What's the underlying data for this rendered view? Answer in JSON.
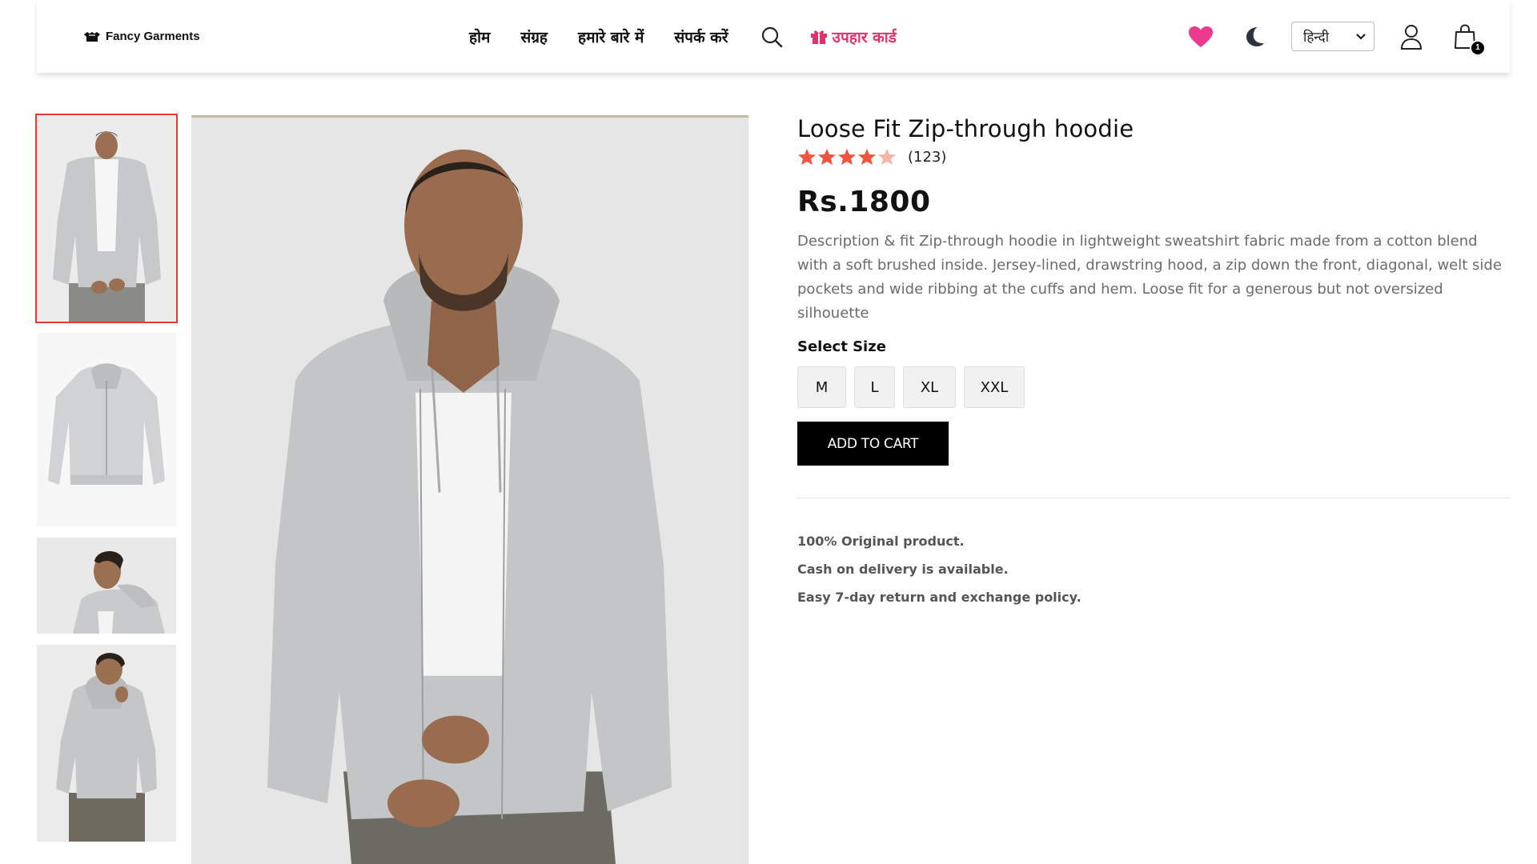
{
  "brand": {
    "name": "Fancy Garments",
    "icon": "logo-mark-icon"
  },
  "nav": {
    "links": [
      "होम",
      "संग्रह",
      "हमारे बारे में",
      "संपर्क करें"
    ],
    "search_icon": "search-icon",
    "gift_card": {
      "label": "उपहार कार्ड",
      "icon": "gift-icon",
      "color": "#e0336e"
    }
  },
  "header_actions": {
    "wishlist_icon": "heart-icon",
    "wishlist_color": "#ee3a8c",
    "theme_icon": "moon-icon",
    "language": {
      "selected": "हिन्दी"
    },
    "user_icon": "user-icon",
    "cart_icon": "shopping-bag-icon",
    "cart_count": "1"
  },
  "gallery": {
    "thumbnails": [
      {
        "alt": "front view",
        "selected": true
      },
      {
        "alt": "flat lay"
      },
      {
        "alt": "side view"
      },
      {
        "alt": "back view"
      }
    ],
    "main": {
      "alt": "model wearing grey zip hoodie"
    }
  },
  "product": {
    "title": "Loose Fit Zip-through hoodie",
    "rating": 4,
    "rating_max": 5,
    "rating_count": "(123)",
    "price": "Rs.1800",
    "description": "Description & fit Zip-through hoodie in lightweight sweatshirt fabric made from a cotton blend with a soft brushed inside. Jersey-lined, drawstring hood, a zip down the front, diagonal, welt side pockets and wide ribbing at the cuffs and hem. Loose fit for a generous but not oversized silhouette",
    "size_label": "Select Size",
    "sizes": [
      "M",
      "L",
      "XL",
      "XXL"
    ],
    "add_to_cart": "ADD TO CART",
    "features": [
      "100% Original product.",
      "Cash on delivery is available.",
      "Easy 7-day return and exchange policy."
    ],
    "star_color": "#f1543f",
    "star_empty_color": "#f7b5a8"
  }
}
